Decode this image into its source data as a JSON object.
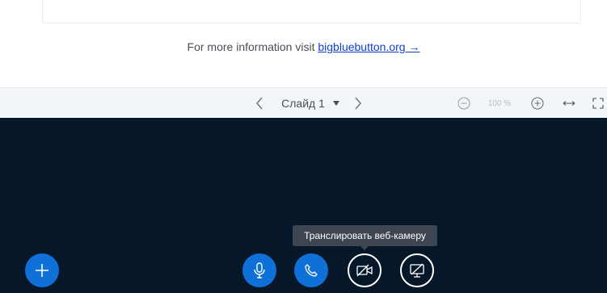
{
  "info": {
    "prefix": "For more information visit ",
    "link": "bigbluebutton.org →"
  },
  "toolbar": {
    "slide_label": "Слайд 1",
    "zoom": "100 %"
  },
  "tooltip": {
    "text": "Транслировать веб-камеру"
  },
  "icons": {
    "prev": "chevron-left-icon",
    "dropdown": "caret-down-icon",
    "next": "chevron-right-icon",
    "zoom_out": "zoom-out-icon",
    "zoom_in": "zoom-in-icon",
    "fit_width": "fit-width-icon",
    "fullscreen": "fullscreen-icon",
    "actions": "plus-icon",
    "mic": "microphone-icon",
    "phone": "phone-icon",
    "webcam": "webcam-off-icon",
    "screenshare": "screenshare-off-icon"
  },
  "colors": {
    "primary": "#0f70d7",
    "background_dark": "#06172a",
    "toolbar_bg": "#f3f6f9",
    "link": "#0f3fcf",
    "tooltip_bg": "#3c4550"
  }
}
